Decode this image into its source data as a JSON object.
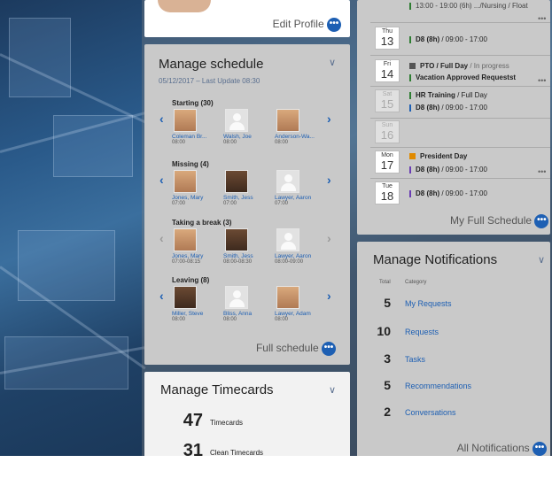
{
  "profile": {
    "edit_label": "Edit Profile"
  },
  "schedule": {
    "title": "Manage schedule",
    "date_line": "05/12/2017 – Last Update 08:30",
    "sections": [
      {
        "label": "Starting (30)",
        "people": [
          {
            "name": "Coleman Br...",
            "time": "08:00",
            "photo": true
          },
          {
            "name": "Walsh, Joe",
            "time": "08:00",
            "photo": false
          },
          {
            "name": "Anderson-Wa...",
            "time": "08:00",
            "photo": true
          }
        ]
      },
      {
        "label": "Missing (4)",
        "people": [
          {
            "name": "Jones, Mary",
            "time": "07:00",
            "photo": true
          },
          {
            "name": "Smith, Jess",
            "time": "07:00",
            "photo": true
          },
          {
            "name": "Lawyer, Aaron",
            "time": "07:00",
            "photo": false
          }
        ]
      },
      {
        "label": "Taking a break (3)",
        "people": [
          {
            "name": "Jones, Mary",
            "time": "07:00-08:15",
            "photo": true
          },
          {
            "name": "Smith, Jess",
            "time": "08:00-08:30",
            "photo": true
          },
          {
            "name": "Lawyer, Aaron",
            "time": "08:00-09:00",
            "photo": false
          }
        ]
      },
      {
        "label": "Leaving (8)",
        "people": [
          {
            "name": "Miller, Steve",
            "time": "08:00",
            "photo": true
          },
          {
            "name": "Bliss, Anna",
            "time": "08:00",
            "photo": false
          },
          {
            "name": "Lawyer, Adam",
            "time": "08:00",
            "photo": true
          }
        ]
      }
    ],
    "footer_link": "Full schedule"
  },
  "calendar": {
    "top_event": "13:00 - 19:00 (6h) .../Nursing / Float",
    "rows": [
      {
        "day": "Thu",
        "num": "13",
        "events": [
          {
            "bold": "D8 (8h)",
            "rest": " / 09:00 - 17:00",
            "color": "#2e7d32"
          }
        ]
      },
      {
        "day": "Fri",
        "num": "14",
        "events": [
          {
            "bold": "PTO / Full Day",
            "rest": " / In progress",
            "color": "#555555"
          },
          {
            "bold": "Vacation Approved Requestst",
            "rest": "",
            "color": "#2e7d32"
          }
        ]
      },
      {
        "day": "Sat",
        "num": "15",
        "events": [
          {
            "bold": "HR Training",
            "rest": " / Full Day",
            "color": "#2e7d32"
          },
          {
            "bold": "D8 (8h)",
            "rest": " / 09:00 - 17:00",
            "color": "#1d5fb3"
          }
        ]
      },
      {
        "day": "Sun",
        "num": "16",
        "events": []
      },
      {
        "day": "Mon",
        "num": "17",
        "events": [
          {
            "bold": "President Day",
            "rest": "",
            "color": "#e08a00"
          },
          {
            "bold": "D8 (8h)",
            "rest": " / 09:00 - 17:00",
            "color": "#6a3db3"
          }
        ]
      },
      {
        "day": "Tue",
        "num": "18",
        "events": [
          {
            "bold": "D8 (8h)",
            "rest": " / 09:00 - 17:00",
            "color": "#6a3db3"
          }
        ]
      }
    ],
    "footer_link": "My Full Schedule"
  },
  "notifications": {
    "title": "Manage Notifications",
    "col_total": "Total",
    "col_category": "Category",
    "items": [
      {
        "count": "5",
        "label": "My Requests"
      },
      {
        "count": "10",
        "label": "Requests"
      },
      {
        "count": "3",
        "label": "Tasks"
      },
      {
        "count": "5",
        "label": "Recommendations"
      },
      {
        "count": "2",
        "label": "Conversations"
      }
    ],
    "footer_link": "All Notifications"
  },
  "timecards": {
    "title": "Manage Timecards",
    "items": [
      {
        "count": "47",
        "label": "Timecards"
      },
      {
        "count": "31",
        "label": "Clean Timecards"
      }
    ]
  },
  "icons": {
    "more": "more-dots-icon",
    "chevron": "chevron-down-icon"
  }
}
